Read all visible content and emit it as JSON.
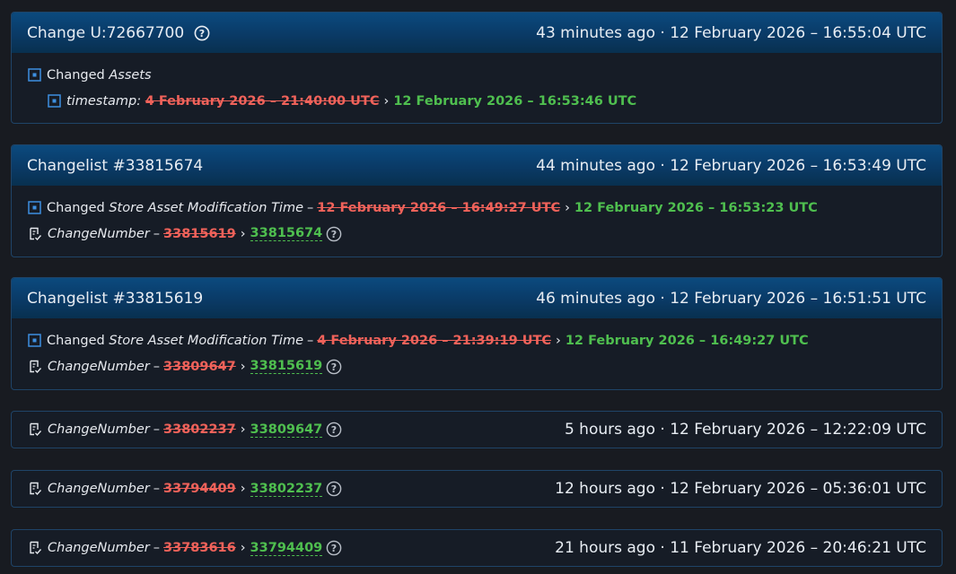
{
  "cards": [
    {
      "title": "Change U:72667700",
      "time": "43 minutes ago · 12 February 2026 – 16:55:04 UTC",
      "line1_prefix": "Changed ",
      "line1_key": "Assets",
      "line2_key": "timestamp:",
      "line2_old": "4 February 2026 – 21:40:00 UTC",
      "line2_new": "12 February 2026 – 16:53:46 UTC"
    },
    {
      "title": "Changelist #33815674",
      "time": "44 minutes ago · 12 February 2026 – 16:53:49 UTC",
      "line1_prefix": "Changed ",
      "line1_key": "Store Asset Modification Time",
      "line1_old": "12 February 2026 – 16:49:27 UTC",
      "line1_new": "12 February 2026 – 16:53:23 UTC",
      "cn_key": "ChangeNumber",
      "cn_old": "33815619",
      "cn_new": "33815674"
    },
    {
      "title": "Changelist #33815619",
      "time": "46 minutes ago · 12 February 2026 – 16:51:51 UTC",
      "line1_prefix": "Changed ",
      "line1_key": "Store Asset Modification Time",
      "line1_old": "4 February 2026 – 21:39:19 UTC",
      "line1_new": "12 February 2026 – 16:49:27 UTC",
      "cn_key": "ChangeNumber",
      "cn_old": "33809647",
      "cn_new": "33815619"
    }
  ],
  "rows": [
    {
      "key": "ChangeNumber",
      "old": "33802237",
      "new": "33809647",
      "time": "5 hours ago · 12 February 2026 – 12:22:09 UTC"
    },
    {
      "key": "ChangeNumber",
      "old": "33794409",
      "new": "33802237",
      "time": "12 hours ago · 12 February 2026 – 05:36:01 UTC"
    },
    {
      "key": "ChangeNumber",
      "old": "33783616",
      "new": "33794409",
      "time": "21 hours ago · 11 February 2026 – 20:46:21 UTC"
    }
  ],
  "separators": {
    "arrow": "›",
    "dash": "–"
  },
  "colors": {
    "removed": "#f0625a",
    "added": "#4fbf4f",
    "header": "#0a3a66",
    "accent": "#3d8fe0"
  },
  "icons": {
    "changed": "square-dot-icon",
    "changenumber": "document-edit-icon",
    "help": "question-circle-icon"
  }
}
